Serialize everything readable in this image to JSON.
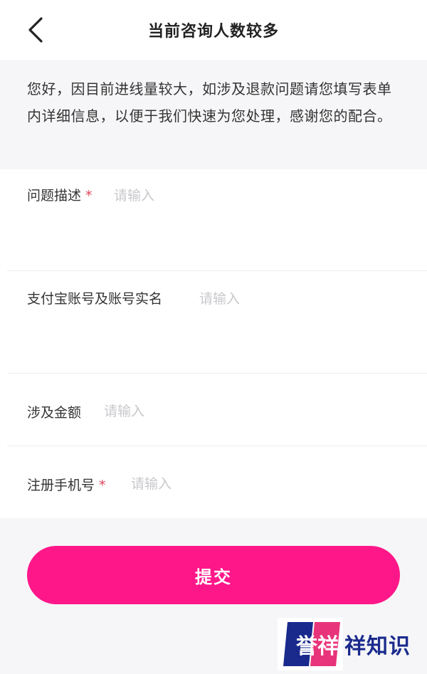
{
  "header": {
    "title": "当前咨询人数较多",
    "back_icon": "chevron-left-icon"
  },
  "notice": {
    "text": "您好，因目前进线量较大，如涉及退款问题请您填写表单内详细信息，以便于我们快速为您处理，感谢您的配合。"
  },
  "form": {
    "fields": [
      {
        "label": "问题描述",
        "required": true,
        "placeholder": "请输入",
        "value": ""
      },
      {
        "label": "支付宝账号及账号实名",
        "required": false,
        "placeholder": "请输入",
        "value": ""
      },
      {
        "label": "涉及金额",
        "required": false,
        "placeholder": "请输入",
        "value": ""
      },
      {
        "label": "注册手机号",
        "required": true,
        "placeholder": "请输入",
        "value": ""
      }
    ],
    "required_mark": "*"
  },
  "submit": {
    "label": "提交",
    "color": "#fe1789"
  },
  "watermark": {
    "logo_text": "誉祥",
    "text": "祥知识"
  }
}
